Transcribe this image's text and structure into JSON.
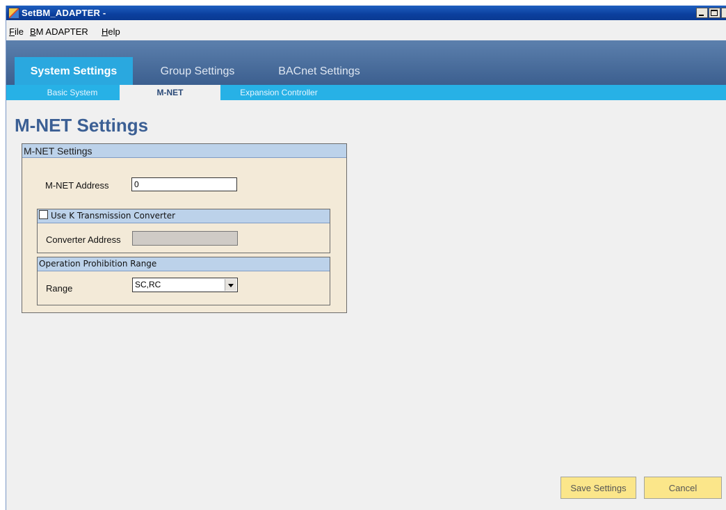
{
  "window": {
    "title": "SetBM_ADAPTER -"
  },
  "menu": [
    {
      "label": "File",
      "mnemonic": "F",
      "rest": "ile"
    },
    {
      "label": "BM ADAPTER",
      "mnemonic": "B",
      "rest": "M ADAPTER"
    },
    {
      "label": "Help",
      "mnemonic": "H",
      "rest": "elp"
    }
  ],
  "main_tabs": [
    {
      "label": "System Settings",
      "active": true
    },
    {
      "label": "Group Settings",
      "active": false
    },
    {
      "label": "BACnet Settings",
      "active": false
    }
  ],
  "sub_tabs": [
    {
      "label": "Basic System",
      "active": false
    },
    {
      "label": "M-NET",
      "active": true
    },
    {
      "label": "Expansion Controller",
      "active": false
    }
  ],
  "page_title": "M-NET Settings",
  "panel": {
    "header": "M-NET Settings",
    "mnet_address_label": "M-NET Address",
    "mnet_address_value": "0",
    "k_converter": {
      "checkbox_label": "Use K Transmission Converter",
      "checked": false,
      "converter_address_label": "Converter Address",
      "converter_address_value": ""
    },
    "prohibition": {
      "header": "Operation Prohibition Range",
      "range_label": "Range",
      "range_value": "SC,RC"
    }
  },
  "buttons": {
    "save": "Save Settings",
    "cancel": "Cancel"
  },
  "colors": {
    "title_bar": "#0b3f9e",
    "tab_bar": "#4a6d9c",
    "active_tab": "#2aa8df",
    "sub_tab_bar": "#27b1e6",
    "page_title": "#3b5f94",
    "panel_bg": "#f3ead8",
    "group_header": "#bcd2ea",
    "button_bg": "#fbe68a"
  },
  "icons": {
    "app": "app-icon",
    "minimize": "minimize-icon",
    "maximize": "maximize-icon",
    "close": "close-icon",
    "dropdown": "chevron-down-icon"
  }
}
